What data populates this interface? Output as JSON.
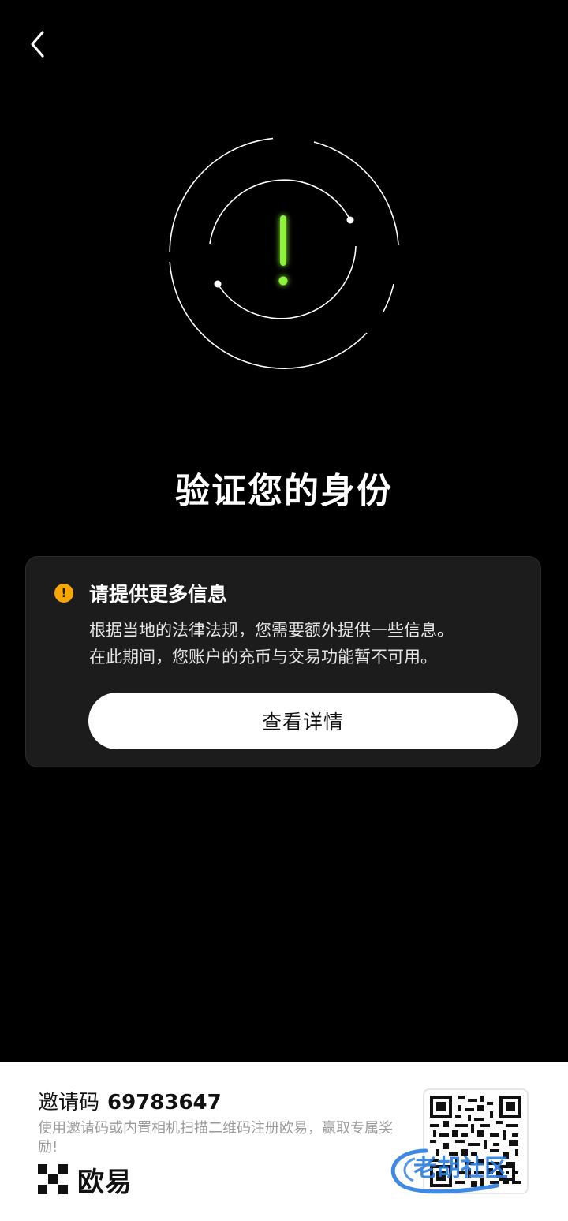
{
  "header": {
    "back_icon": "chevron-left-icon"
  },
  "hero": {
    "icon": "exclamation-icon",
    "accent_color": "#8df23a",
    "ring_color": "#ffffff"
  },
  "main": {
    "title": "验证您的身份"
  },
  "notice_card": {
    "icon": "warning-icon",
    "icon_color": "#f7a600",
    "title": "请提供更多信息",
    "body_line1": "根据当地的法律法规，您需要额外提供一些信息。",
    "body_line2": "在此期间，您账户的充币与交易功能暂不可用。",
    "button_label": "查看详情"
  },
  "footer": {
    "invite_label": "邀请码",
    "invite_code": "69783647",
    "description": "使用邀请码或内置相机扫描二维码注册欧易，赢取专属奖励!",
    "brand_name": "欧易",
    "qr_icon": "qr-code-icon",
    "watermark_text": "老胡社区"
  }
}
